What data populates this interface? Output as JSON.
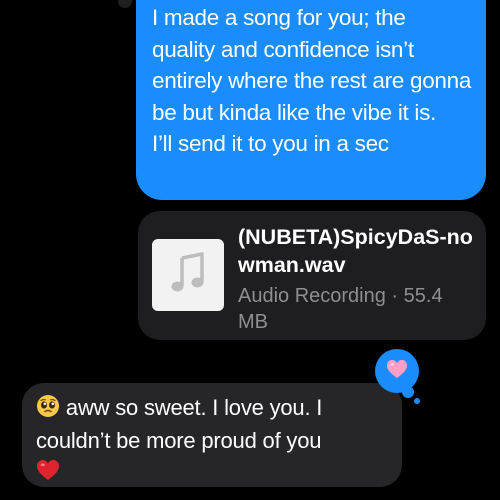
{
  "thread": {
    "outgoing_message": {
      "text": "I made a song for you; the quality and confidence isn’t entirely where the rest are gonna be but kinda like the vibe it is.\nI’ll send it to you in a sec"
    },
    "attachment": {
      "file_name": "(NUBETA)SpicyDaS-nowman.wav",
      "file_meta": "Audio Recording · 55.4 MB",
      "thumbnail_icon": "music-note-icon"
    },
    "reaction": {
      "icon": "pink-heart-icon",
      "color": "#1a8cfb"
    },
    "incoming_message": {
      "leading_emoji": "pleading-face-emoji",
      "text": "aww so sweet. I love you. I couldn’t be more proud of you",
      "trailing_emoji": "red-heart-emoji"
    }
  },
  "colors": {
    "background": "#000000",
    "outgoing_bubble": "#1a8cfb",
    "incoming_bubble": "#262629",
    "attachment_bubble": "#1e1e20",
    "secondary_text": "#8e8e93"
  }
}
